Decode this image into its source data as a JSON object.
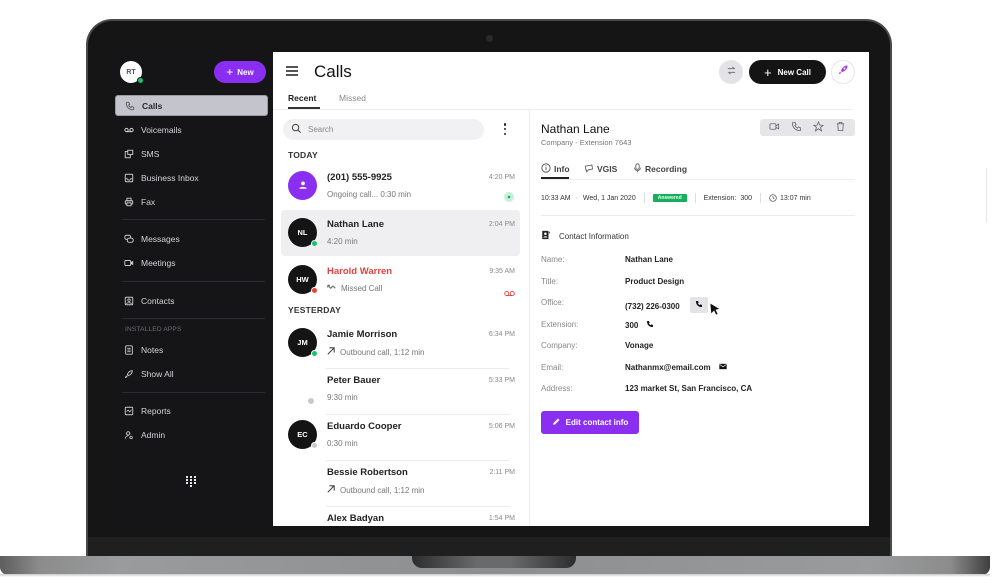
{
  "sidebar": {
    "avatar_initials": "RT",
    "new_button_label": "New",
    "items": [
      {
        "label": "Calls",
        "icon": "phone-icon",
        "active": true
      },
      {
        "label": "Voicemails",
        "icon": "voicemail-icon"
      },
      {
        "label": "SMS",
        "icon": "sms-icon"
      },
      {
        "label": "Business Inbox",
        "icon": "inbox-icon"
      },
      {
        "label": "Fax",
        "icon": "printer-icon"
      },
      {
        "label": "Messages",
        "icon": "chat-bubbles-icon"
      },
      {
        "label": "Meetings",
        "icon": "video-camera-icon"
      },
      {
        "label": "Contacts",
        "icon": "contact-card-icon"
      },
      {
        "label": "Notes",
        "icon": "notes-icon"
      },
      {
        "label": "Show All",
        "icon": "rocket-icon"
      },
      {
        "label": "Reports",
        "icon": "chart-icon"
      },
      {
        "label": "Admin",
        "icon": "admin-user-icon"
      }
    ],
    "installed_apps_label": "INSTALLED APPS",
    "dialpad_icon": "dialpad-icon"
  },
  "header": {
    "title": "Calls",
    "tabs": [
      {
        "label": "Recent",
        "active": true
      },
      {
        "label": "Missed"
      }
    ],
    "new_call_label": "New Call",
    "transfer_icon": "transfer-icon",
    "rocket_icon": "rocket-icon"
  },
  "call_list": {
    "search_placeholder": "Search",
    "groups": [
      {
        "label": "TODAY",
        "calls": [
          {
            "name": "(201) 555-9925",
            "sub": "Ongoing call... 0:30 min",
            "time": "4:20 PM",
            "avatar": "person-icon",
            "status": "ongoing"
          },
          {
            "name": "Nathan Lane",
            "sub": "4:20 min",
            "time": "2:04 PM",
            "initials": "NL",
            "presence": "online",
            "selected": true
          },
          {
            "name": "Harold Warren",
            "sub": "Missed Call",
            "time": "9:35 AM",
            "initials": "HW",
            "presence": "busy",
            "missed": true,
            "status": "voicemail"
          }
        ]
      },
      {
        "label": "YESTERDAY",
        "calls": [
          {
            "name": "Jamie Morrison",
            "sub": "Outbound call, 1:12 min",
            "time": "6:34 PM",
            "initials": "JM",
            "presence": "online",
            "direction": "outbound"
          },
          {
            "name": "Peter Bauer",
            "sub": "9:30 min",
            "time": "5:33 PM",
            "presence": "offline"
          },
          {
            "name": "Eduardo Cooper",
            "sub": "0:30 min",
            "time": "5:06 PM",
            "initials": "EC",
            "presence": "offline"
          },
          {
            "name": "Bessie Robertson",
            "sub": "Outbound call, 1:12 min",
            "time": "2:11 PM",
            "direction": "outbound"
          },
          {
            "name": "Alex Badyan",
            "sub": "",
            "time": "1:54 PM"
          }
        ]
      }
    ]
  },
  "detail": {
    "name": "Nathan Lane",
    "subtitle": "Company -  Extension 7643",
    "tabs": [
      {
        "label": "Info",
        "active": true
      },
      {
        "label": "VGIS"
      },
      {
        "label": "Recording"
      }
    ],
    "meta": {
      "time": "10:33 AM",
      "date": "Wed, 1 Jan 2020",
      "status_badge": "Answered",
      "extension_label": "Extension:",
      "extension": "300",
      "duration": "13:07 min"
    },
    "contact_heading": "Contact Information",
    "fields": [
      {
        "label": "Name:",
        "value": "Nathan Lane"
      },
      {
        "label": "Title:",
        "value": "Product  Design"
      },
      {
        "label": "Office:",
        "value": "(732) 226-0300"
      },
      {
        "label": "Extension:",
        "value": "300"
      },
      {
        "label": "Company:",
        "value": "Vonage"
      },
      {
        "label": "Email:",
        "value": "Nathanmx@email.com"
      },
      {
        "label": "Address:",
        "value": "123 market St, San Francisco, CA"
      }
    ],
    "edit_button_label": "Edit contact info"
  },
  "colors": {
    "accent": "#8a2ef2",
    "online": "#19c26b",
    "busy": "#e8423f",
    "answered": "#14b05a",
    "sidebar_bg": "#151517"
  }
}
